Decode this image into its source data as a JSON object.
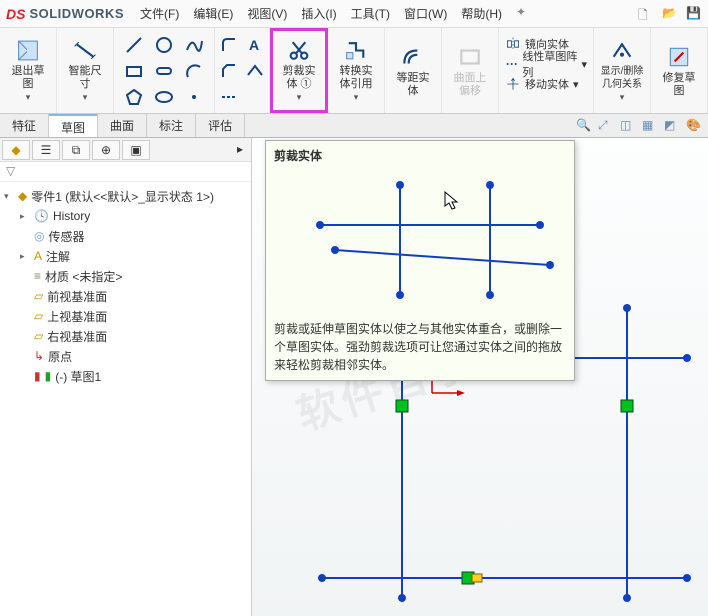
{
  "app": {
    "logo_ds": "DS",
    "logo_text": "SOLIDWORKS"
  },
  "menu": {
    "file": "文件(F)",
    "edit": "编辑(E)",
    "view": "视图(V)",
    "insert": "插入(I)",
    "tools": "工具(T)",
    "window": "窗口(W)",
    "help": "帮助(H)"
  },
  "ribbon": {
    "exit_sketch": "退出草\n图",
    "smart_dim": "智能尺\n寸",
    "trim": "剪裁实\n体 ①",
    "convert": "转换实\n体引用",
    "offset": "等距实\n体",
    "offset_curve": "曲面上\n偏移",
    "mirror": "镜向实体",
    "linear_pattern": "线性草图阵列",
    "move": "移动实体",
    "show_del": "显示/删除\n几何关系",
    "repair": "修复草\n图"
  },
  "tabs": {
    "feature": "特征",
    "sketch": "草图",
    "surface": "曲面",
    "annotate": "标注",
    "evaluate": "评估"
  },
  "tooltip": {
    "title": "剪裁实体",
    "desc": "剪裁或延伸草图实体以使之与其他实体重合，或删除一个草图实体。强劲剪裁选项可让您通过实体之间的拖放来轻松剪裁相邻实体。"
  },
  "tree": {
    "root": "零件1 (默认<<默认>_显示状态 1>)",
    "history": "History",
    "sensors": "传感器",
    "annotations": "注解",
    "material": "材质 <未指定>",
    "front": "前视基准面",
    "top": "上视基准面",
    "right": "右视基准面",
    "origin": "原点",
    "sketch1": "(-) 草图1"
  }
}
